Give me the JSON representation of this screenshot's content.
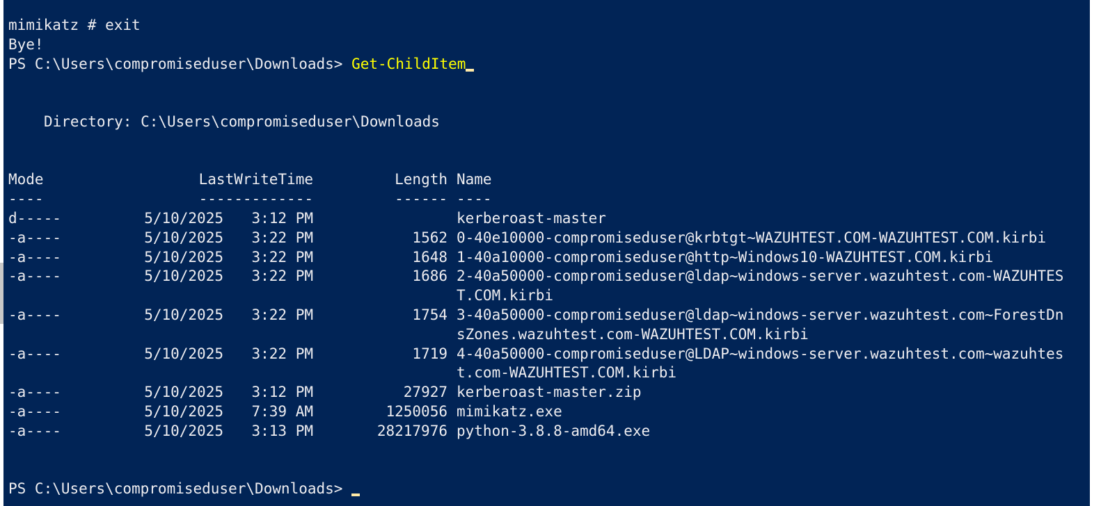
{
  "terminal": {
    "lines_top": [
      "mimikatz # exit",
      "Bye!"
    ],
    "prompt": "PS C:\\Users\\compromiseduser\\Downloads>",
    "command": "Get-ChildItem",
    "directory_line": "Directory: C:\\Users\\compromiseduser\\Downloads",
    "headers": {
      "mode": "Mode",
      "lastwritetime": "LastWriteTime",
      "length": "Length",
      "name": "Name"
    },
    "underlines": {
      "mode": "----",
      "lastwritetime": "-------------",
      "length": "------",
      "name": "----"
    },
    "rows": [
      {
        "mode": "d-----",
        "date": "5/10/2025",
        "time": "3:12 PM",
        "length": "",
        "name": "kerberoast-master",
        "cont": ""
      },
      {
        "mode": "-a----",
        "date": "5/10/2025",
        "time": "3:22 PM",
        "length": "1562",
        "name": "0-40e10000-compromiseduser@krbtgt~WAZUHTEST.COM-WAZUHTEST.COM.kirbi",
        "cont": ""
      },
      {
        "mode": "-a----",
        "date": "5/10/2025",
        "time": "3:22 PM",
        "length": "1648",
        "name": "1-40a10000-compromiseduser@http~Windows10-WAZUHTEST.COM.kirbi",
        "cont": ""
      },
      {
        "mode": "-a----",
        "date": "5/10/2025",
        "time": "3:22 PM",
        "length": "1686",
        "name": "2-40a50000-compromiseduser@ldap~windows-server.wazuhtest.com-WAZUHTES",
        "cont": "T.COM.kirbi"
      },
      {
        "mode": "-a----",
        "date": "5/10/2025",
        "time": "3:22 PM",
        "length": "1754",
        "name": "3-40a50000-compromiseduser@ldap~windows-server.wazuhtest.com~ForestDn",
        "cont": "sZones.wazuhtest.com-WAZUHTEST.COM.kirbi"
      },
      {
        "mode": "-a----",
        "date": "5/10/2025",
        "time": "3:22 PM",
        "length": "1719",
        "name": "4-40a50000-compromiseduser@LDAP~windows-server.wazuhtest.com~wazuhtes",
        "cont": "t.com-WAZUHTEST.COM.kirbi"
      },
      {
        "mode": "-a----",
        "date": "5/10/2025",
        "time": "3:12 PM",
        "length": "27927",
        "name": "kerberoast-master.zip",
        "cont": ""
      },
      {
        "mode": "-a----",
        "date": "5/10/2025",
        "time": "7:39 AM",
        "length": "1250056",
        "name": "mimikatz.exe",
        "cont": ""
      },
      {
        "mode": "-a----",
        "date": "5/10/2025",
        "time": "3:13 PM",
        "length": "28217976",
        "name": "python-3.8.8-amd64.exe",
        "cont": ""
      }
    ],
    "final_prompt": "PS C:\\Users\\compromiseduser\\Downloads>",
    "colors": {
      "background": "#012456",
      "text": "#eeedf0",
      "command": "#ffff00",
      "cursor": "#ffe9a6"
    }
  }
}
